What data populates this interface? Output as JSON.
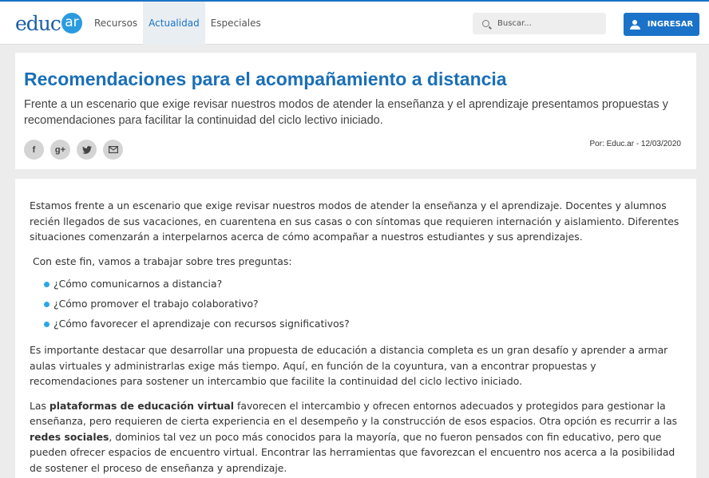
{
  "header": {
    "logo_text": "educ",
    "logo_badge": "ar",
    "nav": [
      {
        "label": "Recursos"
      },
      {
        "label": "Actualidad"
      },
      {
        "label": "Especiales"
      }
    ],
    "search_placeholder": "Buscar...",
    "login_label": "INGRESAR",
    "accent": "#1a73c8"
  },
  "article": {
    "title": "Recomendaciones para el acompañamiento a distancia",
    "subtitle": "Frente a un escenario que exige revisar nuestros modos de atender la enseñanza y el aprendizaje presentamos propuestas y recomendaciones para facilitar la continuidad del ciclo lectivo iniciado.",
    "share": [
      {
        "icon": "facebook-icon",
        "glyph": "f"
      },
      {
        "icon": "google-plus-icon",
        "glyph": "g+"
      },
      {
        "icon": "twitter-icon",
        "glyph": "🐦"
      },
      {
        "icon": "mail-icon",
        "glyph": "✉"
      }
    ],
    "byline": "Por: Educ.ar - 12/03/2020",
    "body": {
      "p1": "Estamos frente a un escenario que exige revisar nuestros modos de atender la enseñanza y el aprendizaje. Docentes y alumnos recién llegados de sus vacaciones, en cuarentena en sus casas o con síntomas que requieren internación y aislamiento. Diferentes situaciones comenzarán a interpelarnos acerca de cómo acompañar a nuestros estudiantes y sus aprendizajes.",
      "p2": " Con este fin, vamos a trabajar sobre tres preguntas:",
      "questions": [
        "¿Cómo comunicarnos a distancia?",
        "¿Cómo promover el trabajo colaborativo?",
        "¿Cómo favorecer el aprendizaje con recursos significativos?"
      ],
      "p3": "Es importante destacar que desarrollar una propuesta de educación a distancia completa es un gran desafío y aprender a armar aulas virtuales y administrarlas exige más tiempo. Aquí, en función de la coyuntura, van a encontrar propuestas y recomendaciones para sostener un intercambio que facilite la continuidad del ciclo lectivo iniciado.",
      "p4_a": "Las ",
      "p4_b": "plataformas de educación virtual",
      "p4_c": " favorecen el intercambio y ofrecen entornos adecuados y protegidos para gestionar la enseñanza, pero requieren de cierta experiencia en el desempeño y la construcción de esos espacios. Otra opción es recurrir a las ",
      "p4_d": "redes sociales",
      "p4_e": ", dominios tal vez un poco más conocidos para la mayoría, que no fueron pensados con fin educativo, pero que pueden ofrecer espacios de encuentro virtual. Encontrar las herramientas que favorezcan el encuentro nos acerca a la posibilidad de sostener el proceso de enseñanza y aprendizaje."
    }
  }
}
